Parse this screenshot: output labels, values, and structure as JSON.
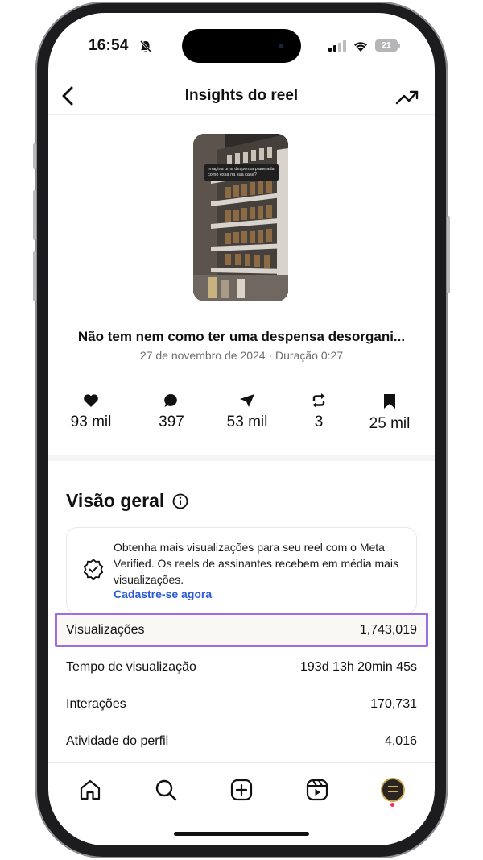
{
  "status_bar": {
    "time": "16:54",
    "battery": "21"
  },
  "header": {
    "title": "Insights do reel"
  },
  "reel": {
    "caption_overlay": "Imagina uma despensa planejada como essa na sua casa?",
    "title": "Não tem nem como ter uma despensa desorgani...",
    "meta": "27 de novembro de 2024 · Duração 0:27"
  },
  "stats": {
    "likes": "93 mil",
    "comments": "397",
    "shares": "53 mil",
    "reposts": "3",
    "saves": "25 mil"
  },
  "overview": {
    "title": "Visão geral",
    "promo_text": "Obtenha mais visualizações para seu reel com o Meta Verified. Os reels de assinantes recebem em média mais visualizações.",
    "promo_link": "Cadastre-se agora",
    "metrics": [
      {
        "label": "Visualizações",
        "value": "1,743,019"
      },
      {
        "label": "Tempo de visualização",
        "value": "193d 13h 20min 45s"
      },
      {
        "label": "Interações",
        "value": "170,731"
      },
      {
        "label": "Atividade do perfil",
        "value": "4,016"
      }
    ]
  },
  "colors": {
    "link": "#2c5bd9",
    "highlight": "#9b6fe0",
    "notification": "#ff2d55"
  }
}
